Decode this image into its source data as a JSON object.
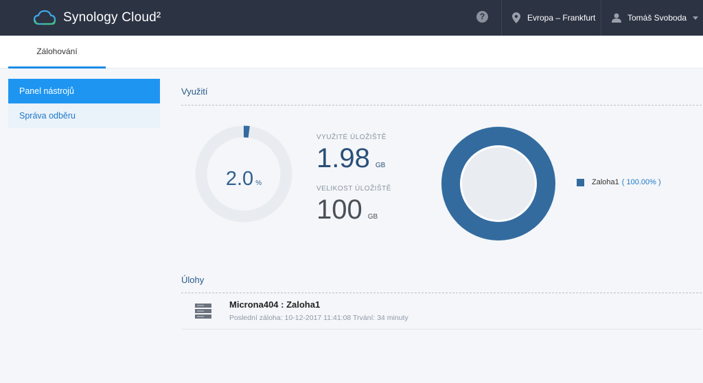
{
  "header": {
    "app_name": "Synology Cloud²",
    "help_label": "?",
    "region": "Evropa – Frankfurt",
    "user_name": "Tomáš Svoboda"
  },
  "tabs": [
    {
      "label": "Zálohování",
      "active": true
    }
  ],
  "sidebar": {
    "items": [
      {
        "label": "Panel nástrojů",
        "active": true
      },
      {
        "label": "Správa odběru",
        "active": false
      }
    ]
  },
  "usage": {
    "title": "Využití",
    "percent": "2.0",
    "percent_unit": "%",
    "percent_value": 2.0,
    "used_label": "VYUŽITÉ ÚLOŽIŠTĚ",
    "used_value": "1.98",
    "used_unit": "GB",
    "size_label": "VELIKOST ÚLOŽIŠTĚ",
    "size_value": "100",
    "size_unit": "GB",
    "legend": {
      "name": "Zaloha1",
      "percent": "( 100.00% )",
      "share": 100.0
    },
    "colors": {
      "accent": "#336b9f",
      "gauge_track": "#e8ecf1"
    }
  },
  "tasks": {
    "title": "Úlohy",
    "items": [
      {
        "name": "Microna404 : Zaloha1",
        "detail": "Poslední záloha: 10-12-2017 11:41:08 Trvání: 34 minuty"
      }
    ]
  }
}
